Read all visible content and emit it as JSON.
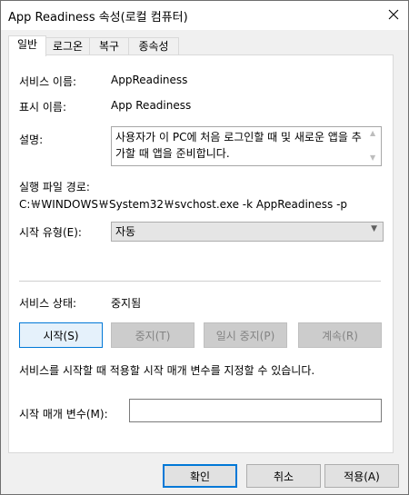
{
  "window": {
    "title": "App Readiness 속성(로컬 컴퓨터)"
  },
  "tabs": [
    "일반",
    "로그온",
    "복구",
    "종속성"
  ],
  "general": {
    "service_name_label": "서비스 이름:",
    "service_name_value": "AppReadiness",
    "display_name_label": "표시 이름:",
    "display_name_value": "App Readiness",
    "description_label": "설명:",
    "description_value": "사용자가 이 PC에 처음 로그인할 때 및 새로운 앱을 추가할 때 앱을 준비합니다.",
    "exe_path_label": "실행 파일 경로:",
    "exe_path_value": "C:￦WINDOWS￦System32￦svchost.exe -k AppReadiness -p",
    "startup_type_label": "시작 유형(E):",
    "startup_type_value": "자동",
    "service_status_label": "서비스 상태:",
    "service_status_value": "중지됨",
    "start_button": "시작(S)",
    "stop_button": "중지(T)",
    "pause_button": "일시 중지(P)",
    "resume_button": "계속(R)",
    "help_text": "서비스를 시작할 때 적용할 시작 매개 변수를 지정할 수 있습니다.",
    "start_params_label": "시작 매개 변수(M):",
    "start_params_value": ""
  },
  "footer": {
    "ok": "확인",
    "cancel": "취소",
    "apply": "적용(A)"
  }
}
